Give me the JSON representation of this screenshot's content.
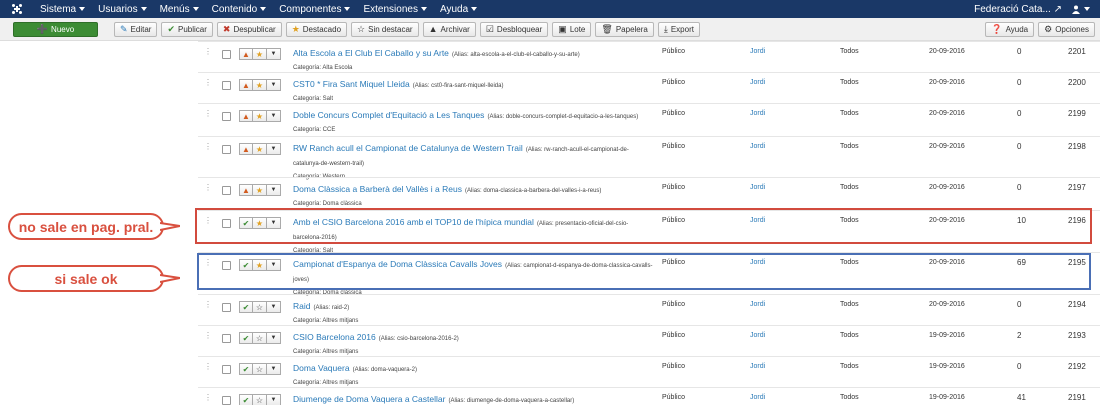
{
  "navbar": {
    "menus": [
      "Sistema",
      "Usuarios",
      "Menús",
      "Contenido",
      "Componentes",
      "Extensiones",
      "Ayuda"
    ],
    "site_name": "Federació Cata...",
    "site_icon": "external-link-icon",
    "user_icon": "user-icon"
  },
  "toolbar": {
    "new": "Nuevo",
    "edit": "Editar",
    "publish": "Publicar",
    "unpublish": "Despublicar",
    "feature": "Destacado",
    "unfeature": "Sin destacar",
    "archive": "Archivar",
    "checkin": "Desbloquear",
    "batch": "Lote",
    "trash": "Papelera",
    "export": "Export",
    "help": "Ayuda",
    "options": "Opciones"
  },
  "colors": {
    "navbar": "#1a3867",
    "new_button": "#3c8c34",
    "link": "#2a7ab8",
    "highlight_red": "#d24b3e",
    "highlight_blue": "#4a6fb5",
    "callout": "#d9503f"
  },
  "rows": [
    {
      "status": "unpublished",
      "featured": true,
      "title": "Alta Escola a El Club El Caballo y su Arte",
      "alias": "(Alias: alta-escola-a-el-club-el-caballo-y-su-arte)",
      "category": "Categoría: Alta Escola",
      "access": "Público",
      "author": "Jordi",
      "language": "Todos",
      "date": "20-09-2016",
      "hits": "0",
      "id": "2201"
    },
    {
      "status": "unpublished",
      "featured": true,
      "title": "CST0 * Fira Sant Miquel Lleida",
      "alias": "(Alias: cst0-fira-sant-miquel-lleida)",
      "category": "Categoría: Salt",
      "access": "Público",
      "author": "Jordi",
      "language": "Todos",
      "date": "20-09-2016",
      "hits": "0",
      "id": "2200"
    },
    {
      "status": "unpublished",
      "featured": true,
      "title": "Doble Concurs Complet d'Equitació a Les Tanques",
      "alias": "(Alias: doble-concurs-complet-d-equitacio-a-les-tanques)",
      "category": "Categoría: CCE",
      "access": "Público",
      "author": "Jordi",
      "language": "Todos",
      "date": "20-09-2016",
      "hits": "0",
      "id": "2199"
    },
    {
      "status": "unpublished",
      "featured": true,
      "title": "RW Ranch acull el Campionat de Catalunya de Western Trail",
      "alias": "(Alias: rw-ranch-acull-el-campionat-de-catalunya-de-western-trail)",
      "category": "Categoría: Western",
      "access": "Público",
      "author": "Jordi",
      "language": "Todos",
      "date": "20-09-2016",
      "hits": "0",
      "id": "2198"
    },
    {
      "status": "unpublished",
      "featured": true,
      "title": "Doma Clàssica a Barberà del Vallès i a Reus",
      "alias": "(Alias: doma-classica-a-barbera-del-valles-i-a-reus)",
      "category": "Categoría: Doma clàssica",
      "access": "Público",
      "author": "Jordi",
      "language": "Todos",
      "date": "20-09-2016",
      "hits": "0",
      "id": "2197"
    },
    {
      "status": "published",
      "featured": true,
      "title": "Amb el CSIO Barcelona 2016 amb el TOP10 de l'hípica mundial",
      "alias": "(Alias: presentacio-oficial-del-csio-barcelona-2016)",
      "category": "Categoría: Salt",
      "access": "Público",
      "author": "Jordi",
      "language": "Todos",
      "date": "20-09-2016",
      "hits": "10",
      "id": "2196"
    },
    {
      "status": "published",
      "featured": true,
      "title": "Campionat d'Espanya de Doma Clàssica Cavalls Joves",
      "alias": "(Alias: campionat-d-espanya-de-doma-classica-cavalls-joves)",
      "category": "Categoría: Doma clàssica",
      "access": "Público",
      "author": "Jordi",
      "language": "Todos",
      "date": "20-09-2016",
      "hits": "69",
      "id": "2195"
    },
    {
      "status": "published",
      "featured": false,
      "title": "Raid",
      "alias": "(Alias: raid-2)",
      "category": "Categoría: Altres mitjans",
      "access": "Público",
      "author": "Jordi",
      "language": "Todos",
      "date": "20-09-2016",
      "hits": "0",
      "id": "2194"
    },
    {
      "status": "published",
      "featured": false,
      "title": "CSIO Barcelona 2016",
      "alias": "(Alias: csio-barcelona-2016-2)",
      "category": "Categoría: Altres mitjans",
      "access": "Público",
      "author": "Jordi",
      "language": "Todos",
      "date": "19-09-2016",
      "hits": "2",
      "id": "2193"
    },
    {
      "status": "published",
      "featured": false,
      "title": "Doma Vaquera",
      "alias": "(Alias: doma-vaquera-2)",
      "category": "Categoría: Altres mitjans",
      "access": "Público",
      "author": "Jordi",
      "language": "Todos",
      "date": "19-09-2016",
      "hits": "0",
      "id": "2192"
    },
    {
      "status": "published",
      "featured": false,
      "title": "Diumenge de Doma Vaquera a Castellar",
      "alias": "(Alias: diumenge-de-doma-vaquera-a-castellar)",
      "category": "",
      "access": "Público",
      "author": "Jordi",
      "language": "Todos",
      "date": "19-09-2016",
      "hits": "41",
      "id": "2191"
    }
  ],
  "annotations": {
    "red_note": "no sale en pag. pral.",
    "blue_note": "si sale ok"
  }
}
